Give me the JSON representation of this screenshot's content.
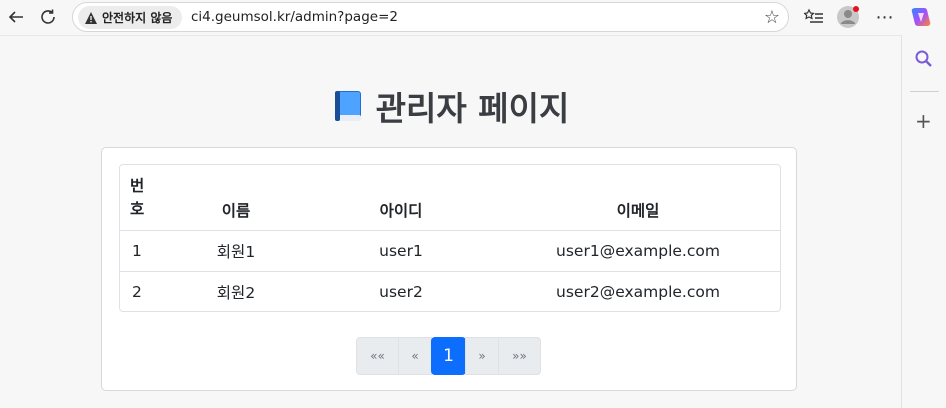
{
  "browser": {
    "security_label": "안전하지 않음",
    "url": "ci4.geumsol.kr/admin?page=2"
  },
  "page": {
    "title": "관리자 페이지",
    "table": {
      "headers": {
        "num_line1": "번",
        "num_line2": "호",
        "name": "이름",
        "id": "아이디",
        "email": "이메일"
      },
      "rows": [
        {
          "num": "1",
          "name": "회원1",
          "id": "user1",
          "email": "user1@example.com"
        },
        {
          "num": "2",
          "name": "회원2",
          "id": "user2",
          "email": "user2@example.com"
        }
      ]
    },
    "pagination": {
      "first": "««",
      "prev": "«",
      "current": "1",
      "next": "»",
      "last": "»»"
    }
  },
  "colors": {
    "accent": "#0d6efd",
    "profile_badge": "#e81123"
  }
}
